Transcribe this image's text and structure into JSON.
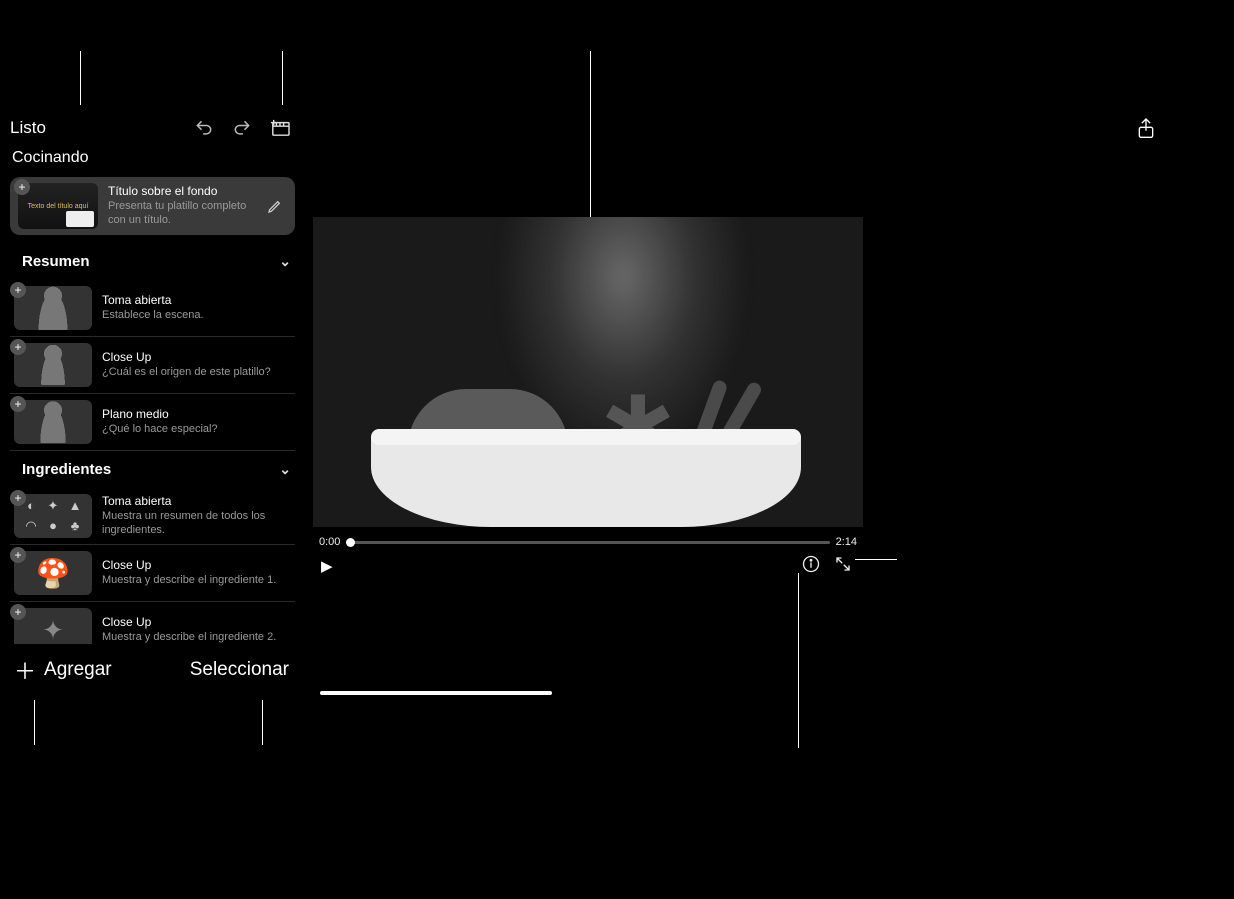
{
  "header": {
    "done_label": "Listo",
    "project_title": "Cocinando"
  },
  "title_card": {
    "name": "Título sobre el fondo",
    "desc": "Presenta tu platillo completo con un título.",
    "thumb_text": "Texto del título aquí"
  },
  "sections": [
    {
      "label": "Resumen",
      "shots": [
        {
          "title": "Toma abierta",
          "desc": "Establece la escena.",
          "thumb": "silhouette-big"
        },
        {
          "title": "Close Up",
          "desc": "¿Cuál es el origen de este platillo?",
          "thumb": "silhouette"
        },
        {
          "title": "Plano medio",
          "desc": "¿Qué lo hace especial?",
          "thumb": "silhouette-med"
        }
      ]
    },
    {
      "label": "Ingredientes",
      "shots": [
        {
          "title": "Toma abierta",
          "desc": "Muestra un resumen de todos los ingredientes.",
          "thumb": "ing-grid"
        },
        {
          "title": "Close Up",
          "desc": "Muestra y describe el ingrediente 1.",
          "thumb": "mushroom"
        },
        {
          "title": "Close Up",
          "desc": "Muestra y describe el ingrediente 2.",
          "thumb": "leaf"
        }
      ]
    }
  ],
  "footer": {
    "add_label": "Agregar",
    "select_label": "Seleccionar"
  },
  "player": {
    "current_time": "0:00",
    "duration": "2:14"
  }
}
